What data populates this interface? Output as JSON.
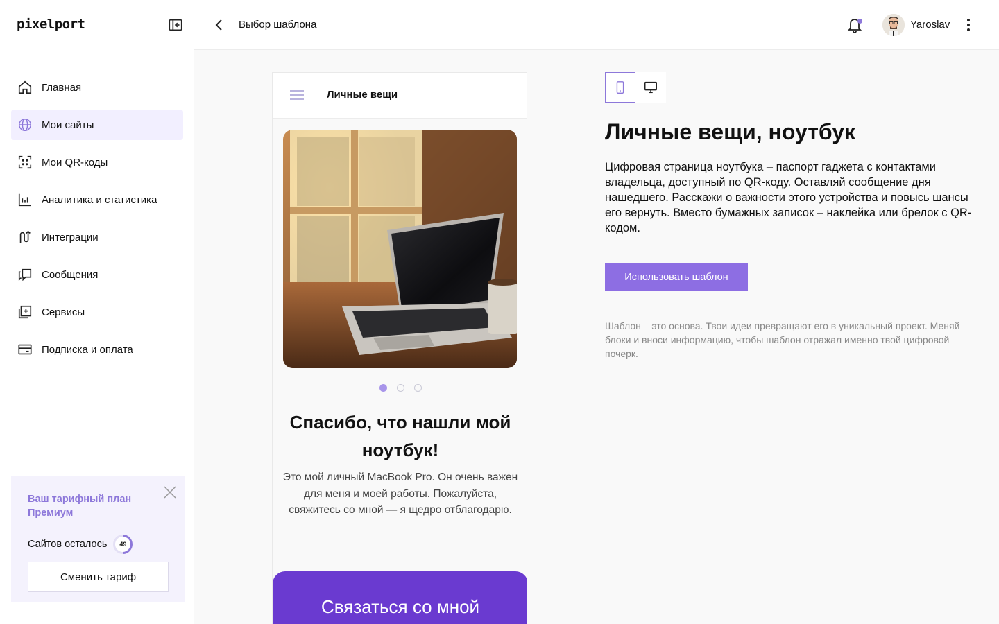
{
  "brand": {
    "logo_text": "pixelport"
  },
  "sidebar": {
    "items": [
      {
        "label": "Главная",
        "icon": "home-icon",
        "active": false
      },
      {
        "label": "Мои сайты",
        "icon": "globe-icon",
        "active": true
      },
      {
        "label": "Мои QR-коды",
        "icon": "qr-scan-icon",
        "active": false
      },
      {
        "label": "Аналитика и статистика",
        "icon": "chart-icon",
        "active": false
      },
      {
        "label": "Интеграции",
        "icon": "integration-icon",
        "active": false
      },
      {
        "label": "Сообщения",
        "icon": "messages-icon",
        "active": false
      },
      {
        "label": "Сервисы",
        "icon": "services-plus-icon",
        "active": false
      },
      {
        "label": "Подписка и оплата",
        "icon": "card-icon",
        "active": false
      }
    ],
    "plan": {
      "title_line1": "Ваш тарифный план",
      "title_line2": "Премиум",
      "sites_left_label": "Сайтов осталось",
      "sites_left_count": "49",
      "sites_left_fraction": 0.49,
      "change_button": "Сменить тариф"
    }
  },
  "header": {
    "title": "Выбор шаблона",
    "username": "Yaroslav",
    "has_notification": true
  },
  "preview": {
    "header_title": "Личные вещи",
    "slide_count": 3,
    "active_slide": 1,
    "heading": "Спасибо, что нашли мой ноутбук!",
    "body": "Это мой личный MacBook Pro. Он очень важен для меня и моей работы. Пожалуйста, свяжитесь со мной — я щедро отблагодарю.",
    "cta": "Связаться со мной"
  },
  "template": {
    "view_modes": [
      "mobile",
      "desktop"
    ],
    "active_view": "mobile",
    "title": "Личные вещи, ноутбук",
    "description": "Цифровая страница ноутбука – паспорт гаджета с контактами владельца, доступный по QR-коду. Оставляй сообщение дня нашедшего. Расскажи о важности этого устройства и повысь шансы его вернуть. Вместо бумажных записок – наклейка или брелок с QR-кодом.",
    "use_button": "Использовать шаблон",
    "note": "Шаблон – это основа. Твои идеи превращают его в уникальный проект. Меняй блоки и вноси информацию, чтобы шаблон отражал именно твой цифровой почерк."
  },
  "colors": {
    "accent": "#8d6ee3",
    "accent_dark": "#6a3ad0",
    "active_nav_bg": "#f2efff",
    "plan_bg": "#f4f2fd"
  }
}
